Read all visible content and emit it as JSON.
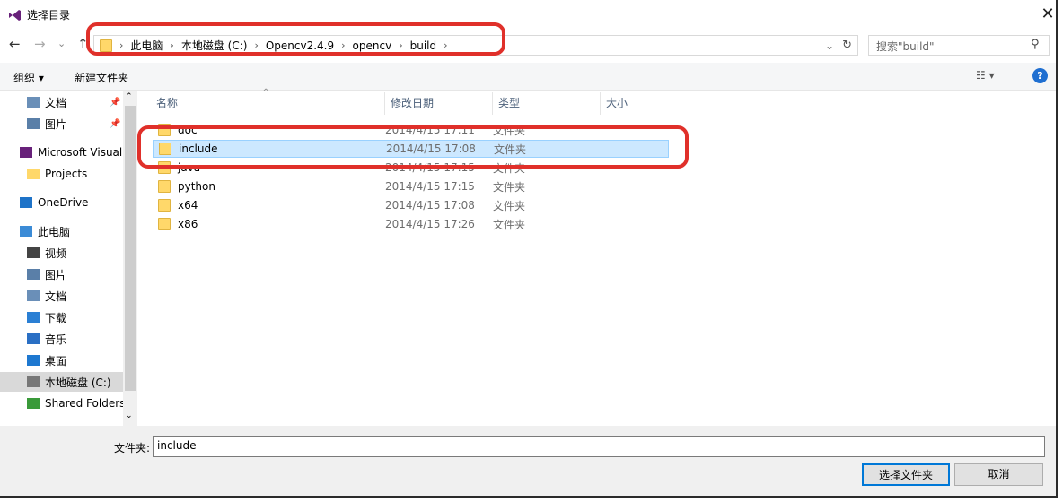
{
  "window": {
    "title": "选择目录",
    "close": "✕"
  },
  "nav": {
    "back": "←",
    "forward": "→",
    "recent": "⌄",
    "up": "↑"
  },
  "address": {
    "crumbs": [
      "此电脑",
      "本地磁盘 (C:)",
      "Opencv2.4.9",
      "opencv",
      "build"
    ],
    "dropdown": "⌄",
    "refresh": "↻"
  },
  "search": {
    "placeholder": "搜索\"build\""
  },
  "toolbar": {
    "organize": "组织 ▾",
    "new_folder": "新建文件夹",
    "view": "☷ ▾",
    "help": "?"
  },
  "sidebar": {
    "items": [
      {
        "label": "文档",
        "icon": "document-icon"
      },
      {
        "label": "图片",
        "icon": "pictures-icon"
      },
      {
        "label": "Microsoft Visual",
        "icon": "visual-studio-icon"
      },
      {
        "label": "Projects",
        "icon": "folder-icon"
      },
      {
        "label": "OneDrive",
        "icon": "onedrive-icon"
      },
      {
        "label": "此电脑",
        "icon": "computer-icon"
      },
      {
        "label": "视频",
        "icon": "video-icon"
      },
      {
        "label": "图片",
        "icon": "pictures-icon"
      },
      {
        "label": "文档",
        "icon": "document-icon"
      },
      {
        "label": "下载",
        "icon": "download-icon"
      },
      {
        "label": "音乐",
        "icon": "music-icon"
      },
      {
        "label": "桌面",
        "icon": "desktop-icon"
      },
      {
        "label": "本地磁盘 (C:)",
        "icon": "drive-icon",
        "selected": true
      },
      {
        "label": "Shared Folders",
        "icon": "network-drive-icon"
      }
    ]
  },
  "columns": [
    "名称",
    "修改日期",
    "类型",
    "大小"
  ],
  "files": [
    {
      "name": "doc",
      "date": "2014/4/15 17:11",
      "type": "文件夹"
    },
    {
      "name": "include",
      "date": "2014/4/15 17:08",
      "type": "文件夹",
      "selected": true
    },
    {
      "name": "java",
      "date": "2014/4/15 17:15",
      "type": "文件夹"
    },
    {
      "name": "python",
      "date": "2014/4/15 17:15",
      "type": "文件夹"
    },
    {
      "name": "x64",
      "date": "2014/4/15 17:08",
      "type": "文件夹"
    },
    {
      "name": "x86",
      "date": "2014/4/15 17:26",
      "type": "文件夹"
    }
  ],
  "footer": {
    "folder_label": "文件夹:",
    "folder_value": "include",
    "select_button": "选择文件夹",
    "cancel_button": "取消"
  },
  "colors": {
    "highlight": "#e0302a",
    "selection": "#cce8ff",
    "accent": "#0078d7"
  }
}
